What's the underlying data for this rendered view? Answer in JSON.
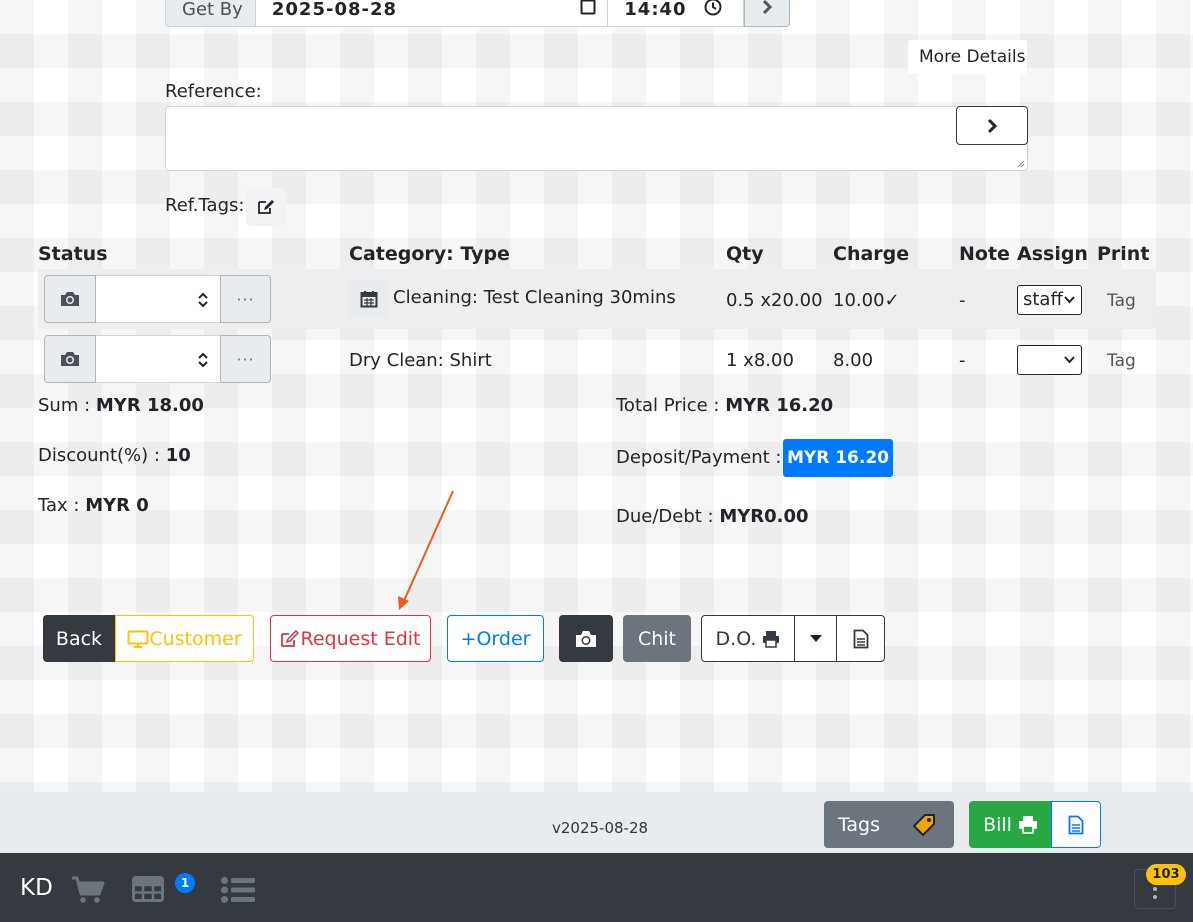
{
  "getby": {
    "label": "Get By",
    "date": "2025-08-28",
    "time": "14:40"
  },
  "more_details_label": "More Details",
  "reference": {
    "label": "Reference:",
    "value": ""
  },
  "ref_tags_label": "Ref.Tags:",
  "table": {
    "headers": {
      "status": "Status",
      "category": "Category: Type",
      "qty": "Qty",
      "charge": "Charge",
      "note": "Note",
      "assign": "Assign",
      "print": "Print"
    },
    "rows": [
      {
        "category": "Cleaning: Test Cleaning 30mins",
        "qty": "0.5 x20.00",
        "charge": "10.00✓",
        "note": "-",
        "assign": "staff",
        "print": "Tag"
      },
      {
        "category": "Dry Clean: Shirt",
        "qty": "1 x8.00",
        "charge": "8.00",
        "note": "-",
        "assign": "",
        "print": "Tag"
      }
    ],
    "dots_label": "···"
  },
  "summary": {
    "sum_label": "Sum : ",
    "sum_value": "MYR 18.00",
    "discount_label": "Discount(%) : ",
    "discount_value": "10",
    "tax_label": "Tax : ",
    "tax_value": "MYR 0",
    "total_label": "Total Price : ",
    "total_value": "MYR 16.20",
    "deposit_label": "Deposit/Payment : ",
    "deposit_value": "MYR 16.20",
    "due_label": "Due/Debt : ",
    "due_value": "MYR0.00"
  },
  "actions": {
    "back": "Back",
    "customer": "Customer",
    "request_edit": "Request Edit",
    "order": "+Order",
    "chit": "Chit",
    "do": "D.O."
  },
  "footer": {
    "version": "v2025-08-28",
    "tags": "Tags",
    "bill": "Bill"
  },
  "navbar": {
    "brand": "KD",
    "table_badge": "1",
    "menu_count": "103"
  },
  "colors": {
    "primary": "#007bff",
    "success": "#28a745",
    "danger": "#dc3545",
    "warning": "#ffc107",
    "dark": "#343a40",
    "secondary": "#6c757d",
    "annotation_arrow": "#f05a1c"
  }
}
